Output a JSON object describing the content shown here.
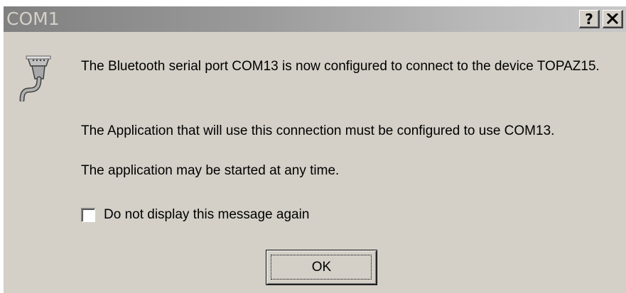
{
  "window": {
    "title": "COM1",
    "help_label": "?",
    "close_label": "✕"
  },
  "icon": "serial-port-cable-icon",
  "message": {
    "line1": "The Bluetooth serial port COM13 is now configured to connect to the device TOPAZ15.",
    "line2": "The Application that will use this connection must be configured to use COM13.",
    "line3": "The application may be started at any time."
  },
  "checkbox": {
    "label": "Do not display this message again",
    "checked": false
  },
  "buttons": {
    "ok_label": "OK"
  },
  "colors": {
    "dialog_bg": "#d4d0c8",
    "title_gradient_start": "#808080",
    "title_gradient_end": "#c8c8c8",
    "title_text": "#d4d0c8"
  }
}
